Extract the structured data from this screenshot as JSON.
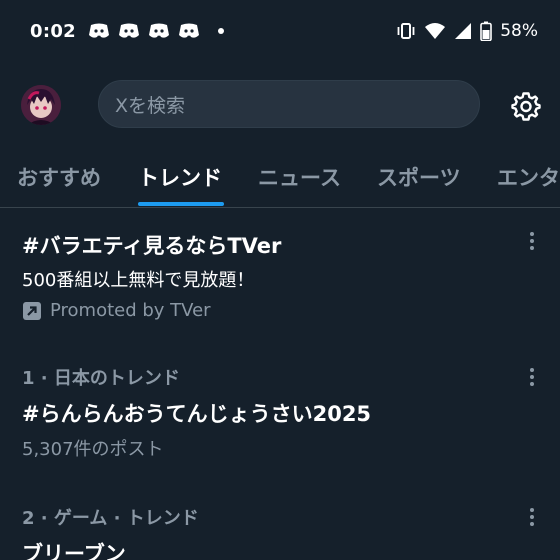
{
  "status_bar": {
    "time": "0:02",
    "notification_icons": [
      "discord-icon",
      "discord-icon",
      "discord-icon",
      "discord-icon"
    ],
    "battery": "58%"
  },
  "header": {
    "search_placeholder": "Xを検索"
  },
  "tabs": [
    {
      "label": "おすすめ",
      "active": false
    },
    {
      "label": "トレンド",
      "active": true
    },
    {
      "label": "ニュース",
      "active": false
    },
    {
      "label": "スポーツ",
      "active": false
    },
    {
      "label": "エンタ",
      "active": false
    }
  ],
  "promoted_trend": {
    "title": "#バラエティ見るならTVer",
    "description": "500番組以上無料で見放題！",
    "promoted_by": "Promoted by TVer"
  },
  "trends": [
    {
      "meta": "1 · 日本のトレンド",
      "title": "#らんらんおうてんじょうさい2025",
      "count": "5,307件のポスト"
    },
    {
      "meta": "2 · ゲーム · トレンド",
      "title": "ブリーブン"
    }
  ],
  "colors": {
    "background": "#15202b",
    "accent": "#1d9bf0",
    "secondary_text": "#8b98a5"
  }
}
